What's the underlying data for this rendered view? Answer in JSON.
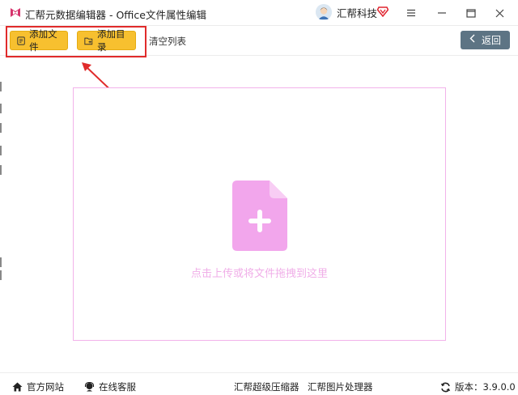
{
  "titlebar": {
    "title": "汇帮元数据编辑器 - Office文件属性编辑",
    "brand_name": "汇帮科技",
    "minimize_glyph": "☰",
    "colors": {
      "logo": "#d6336c",
      "vip": "#e0242f"
    }
  },
  "toolbar": {
    "add_file_label": "添加文件",
    "add_folder_label": "添加目录",
    "clear_list_label": "清空列表",
    "back_label": "返回",
    "colors": {
      "button_bg": "#f7c02f",
      "back_bg": "#5d7484"
    }
  },
  "drop_zone": {
    "hint": "点击上传或将文件拖拽到这里",
    "colors": {
      "icon": "#f2a6ec",
      "border": "#f2b2ea"
    }
  },
  "annotation": {
    "color": "#e02b2b"
  },
  "statusbar": {
    "website_label": "官方网站",
    "support_label": "在线客服",
    "compressor_label": "汇帮超级压缩器",
    "image_tool_label": "汇帮图片处理器",
    "version_label": "版本：3.9.0.0"
  }
}
